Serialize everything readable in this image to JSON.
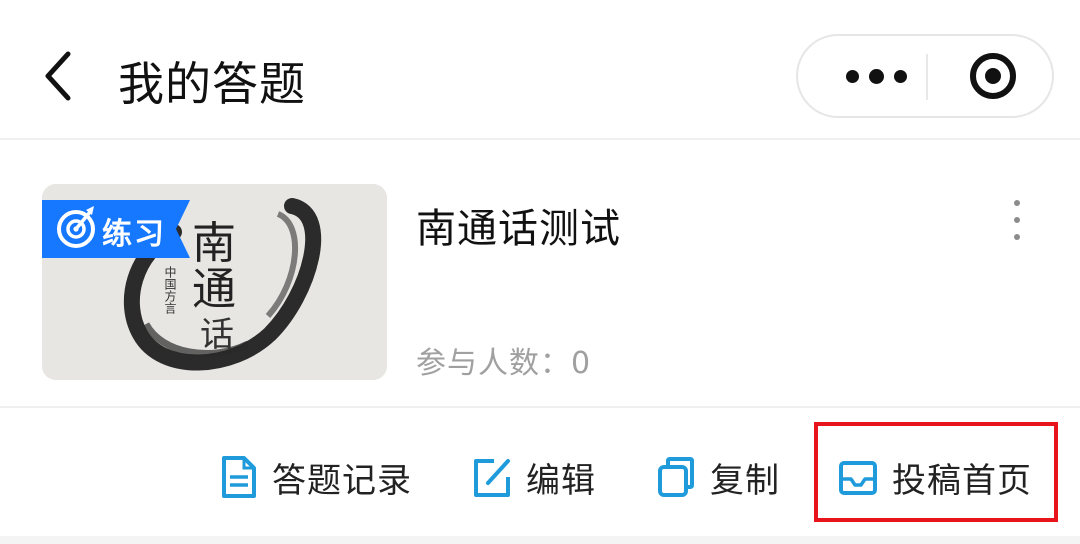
{
  "header": {
    "title": "我的答题",
    "back_icon": "chevron-left-icon",
    "more_icon": "more-dots-icon",
    "record_icon": "record-circle-icon"
  },
  "card": {
    "tag": "练习",
    "title": "南通话测试",
    "participants": "参与人数：0",
    "thumb_text": "南通话",
    "thumb_small": "中国方言"
  },
  "actions": {
    "records": "答题记录",
    "edit": "编辑",
    "copy": "复制",
    "submit_home": "投稿首页"
  },
  "colors": {
    "accent": "#1f9bdc",
    "tag_bg": "#1677ff",
    "highlight": "#e8141b"
  }
}
